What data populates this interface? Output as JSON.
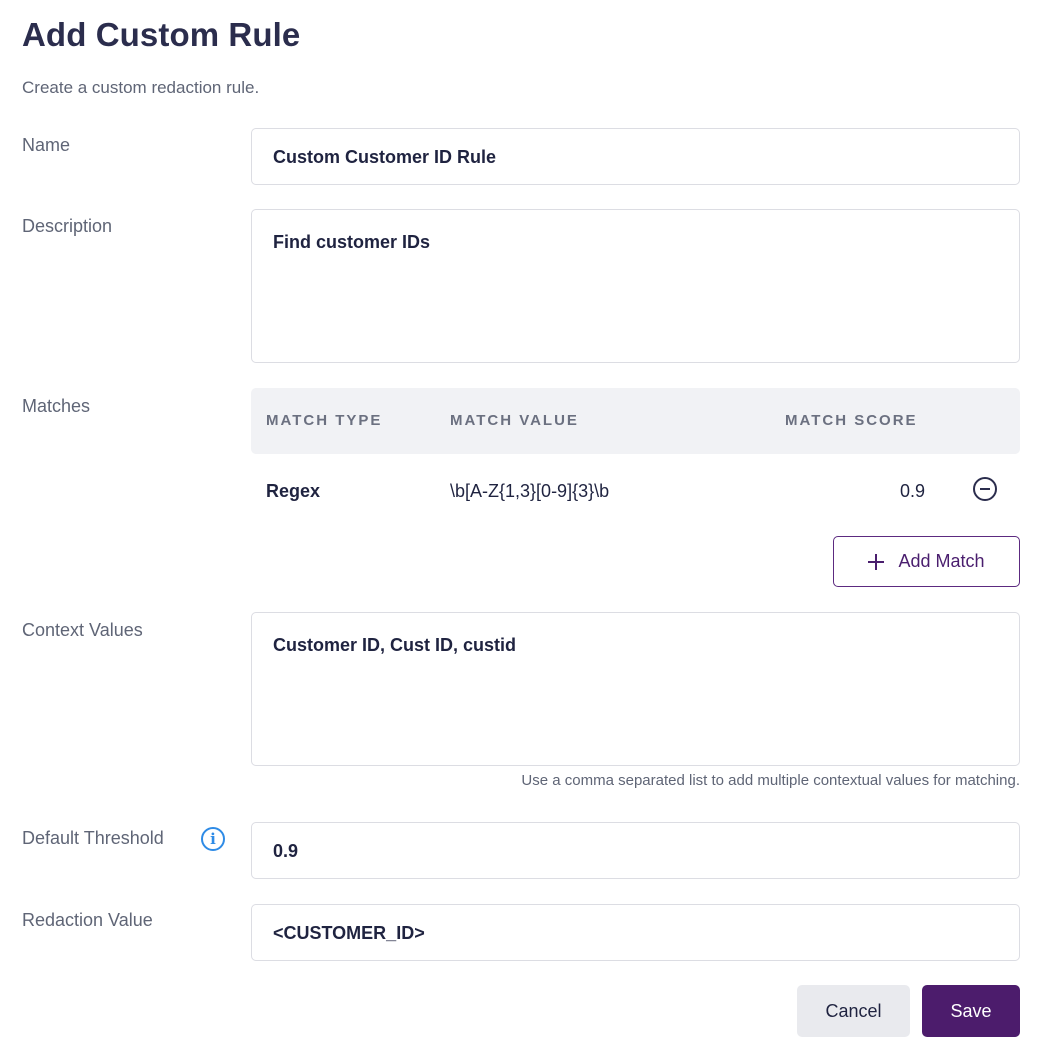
{
  "header": {
    "title": "Add Custom Rule",
    "subtitle": "Create a custom redaction rule."
  },
  "form": {
    "name": {
      "label": "Name",
      "value": "Custom Customer ID Rule"
    },
    "description": {
      "label": "Description",
      "value": "Find customer IDs"
    },
    "matches": {
      "label": "Matches",
      "columns": [
        "MATCH TYPE",
        "MATCH VALUE",
        "MATCH SCORE"
      ],
      "rows": [
        {
          "type": "Regex",
          "value": "\\b[A-Z{1,3}[0-9]{3}\\b",
          "score": "0.9"
        }
      ],
      "remove_icon": "minus-circle-icon",
      "add_label": "Add Match",
      "add_icon": "plus-icon"
    },
    "context_values": {
      "label": "Context Values",
      "value": "Customer ID, Cust ID, custid",
      "hint": "Use a comma separated list to add multiple contextual values for matching."
    },
    "default_threshold": {
      "label": "Default Threshold",
      "info_icon": "info-icon",
      "value": "0.9"
    },
    "redaction_value": {
      "label": "Redaction Value",
      "value": "<CUSTOMER_ID>"
    }
  },
  "actions": {
    "cancel_label": "Cancel",
    "save_label": "Save"
  },
  "colors": {
    "primary": "#4c1c6c",
    "info": "#2e8be6",
    "title": "#2b2d4d"
  }
}
